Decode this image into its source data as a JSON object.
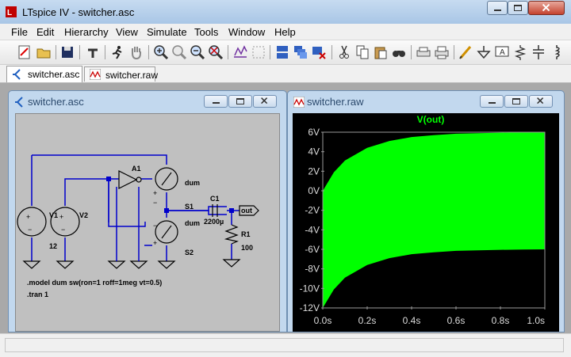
{
  "window": {
    "title": "LTspice IV - switcher.asc"
  },
  "menu": [
    "File",
    "Edit",
    "Hierarchy",
    "View",
    "Simulate",
    "Tools",
    "Window",
    "Help"
  ],
  "tabs": [
    {
      "label": "switcher.asc"
    },
    {
      "label": "switcher.raw"
    }
  ],
  "schematic": {
    "title": "switcher.asc",
    "labels": {
      "v1": "V1",
      "v2": "V2",
      "v1_value": "12",
      "a1": "A1",
      "s1": "S1",
      "s2": "S2",
      "s1_model": "dum",
      "s2_model": "dum",
      "c1": "C1",
      "c1_value": "2200µ",
      "r1": "R1",
      "r1_value": "100",
      "out": "out",
      "plus1": "+",
      "minus1": "−",
      "plus2": "+",
      "minus2": "−"
    },
    "directives": [
      ".model dum sw(ron=1 roff=1meg vt=0.5)",
      ".tran 1"
    ]
  },
  "waveform": {
    "title": "switcher.raw"
  },
  "chart_data": {
    "type": "area",
    "title": "V(out)",
    "xlabel": "",
    "ylabel": "",
    "x_ticks": [
      "0.0s",
      "0.2s",
      "0.4s",
      "0.6s",
      "0.8s",
      "1.0s"
    ],
    "y_ticks": [
      "6V",
      "4V",
      "2V",
      "0V",
      "-2V",
      "-4V",
      "-6V",
      "-8V",
      "-10V",
      "-12V"
    ],
    "xlim": [
      0,
      1
    ],
    "ylim": [
      -12,
      6
    ],
    "series": [
      {
        "name": "V(out)",
        "color": "#00ff00",
        "x": [
          0,
          0.05,
          0.1,
          0.2,
          0.3,
          0.4,
          0.5,
          0.6,
          0.7,
          0.8,
          0.9,
          1.0
        ],
        "upper": [
          0.0,
          1.9,
          3.1,
          4.4,
          5.1,
          5.5,
          5.7,
          5.85,
          5.9,
          5.95,
          5.98,
          6.0
        ],
        "lower": [
          -12.0,
          -10.1,
          -8.9,
          -7.6,
          -6.9,
          -6.5,
          -6.3,
          -6.15,
          -6.1,
          -6.05,
          -6.02,
          -6.0
        ]
      }
    ],
    "background": "#000000",
    "grid": false
  }
}
